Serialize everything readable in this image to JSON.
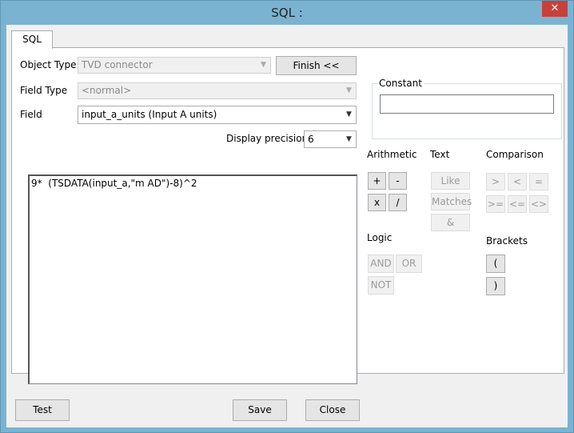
{
  "window": {
    "title": "SQL :",
    "close_glyph": "✕"
  },
  "tab": {
    "label": "SQL"
  },
  "object_type": {
    "label": "Object Type",
    "value": "TVD connector"
  },
  "finish_button": "Finish <<",
  "field_type": {
    "label": "Field Type",
    "value": "<normal>"
  },
  "field": {
    "label": "Field",
    "value": "input_a_units  (Input A units)"
  },
  "display_precision": {
    "label": "Display precision",
    "value": "6"
  },
  "sql_text": "9*  (TSDATA(input_a,\"m AD\")-8)^2",
  "constant": {
    "label": "Constant",
    "value": ""
  },
  "sections": {
    "arithmetic": "Arithmetic",
    "text": "Text",
    "comparison": "Comparison",
    "logic": "Logic",
    "brackets": "Brackets"
  },
  "arithmetic_ops": [
    "+",
    "-",
    "x",
    "/"
  ],
  "text_ops": [
    "Like",
    "Matches",
    "&"
  ],
  "comparison_ops": [
    ">",
    "<",
    "=",
    ">=",
    "<=",
    "<>"
  ],
  "logic_ops": [
    "AND",
    "OR",
    "NOT"
  ],
  "bracket_ops": [
    "(",
    ")"
  ],
  "footer": {
    "test": "Test",
    "save": "Save",
    "close": "Close"
  }
}
